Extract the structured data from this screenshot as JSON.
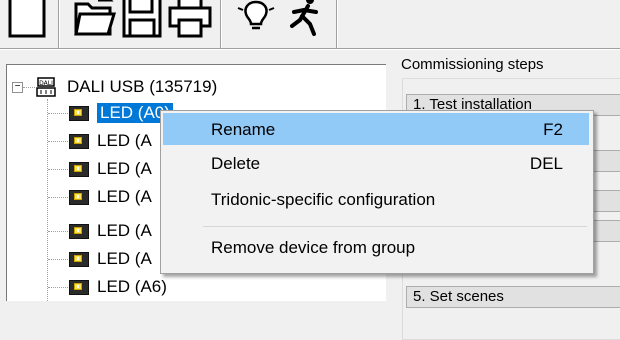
{
  "toolbar": {
    "buttons": [
      {
        "name": "new-icon"
      },
      {
        "name": "open-folder-icon"
      },
      {
        "name": "save-disk-icon"
      },
      {
        "name": "print-icon"
      },
      {
        "name": "lightbulb-icon"
      },
      {
        "name": "running-person-icon"
      }
    ]
  },
  "tree": {
    "root": {
      "label": "DALI USB (135719)",
      "icon": "dali-bus-icon",
      "expander": "−"
    },
    "items": [
      {
        "label": "LED (A0)",
        "selected": true
      },
      {
        "label": "LED (A"
      },
      {
        "label": "LED (A"
      },
      {
        "label": "LED (A"
      },
      {
        "label": "LED (A"
      },
      {
        "label": "LED (A"
      },
      {
        "label": "LED (A6)"
      }
    ]
  },
  "commissioning": {
    "title": "Commissioning steps",
    "steps": [
      {
        "label": "1. Test installation"
      },
      {
        "label": ""
      },
      {
        "label": ""
      },
      {
        "label": ""
      },
      {
        "label": "5. Set scenes"
      }
    ]
  },
  "context_menu": {
    "items": [
      {
        "label": "Rename",
        "shortcut": "F2",
        "highlighted": true
      },
      {
        "label": "Delete",
        "shortcut": "DEL"
      },
      {
        "label": "Tridonic-specific configuration",
        "shortcut": ""
      },
      {
        "label": "Remove device from group",
        "shortcut": ""
      }
    ],
    "highlight_color": "#91c9f7"
  }
}
